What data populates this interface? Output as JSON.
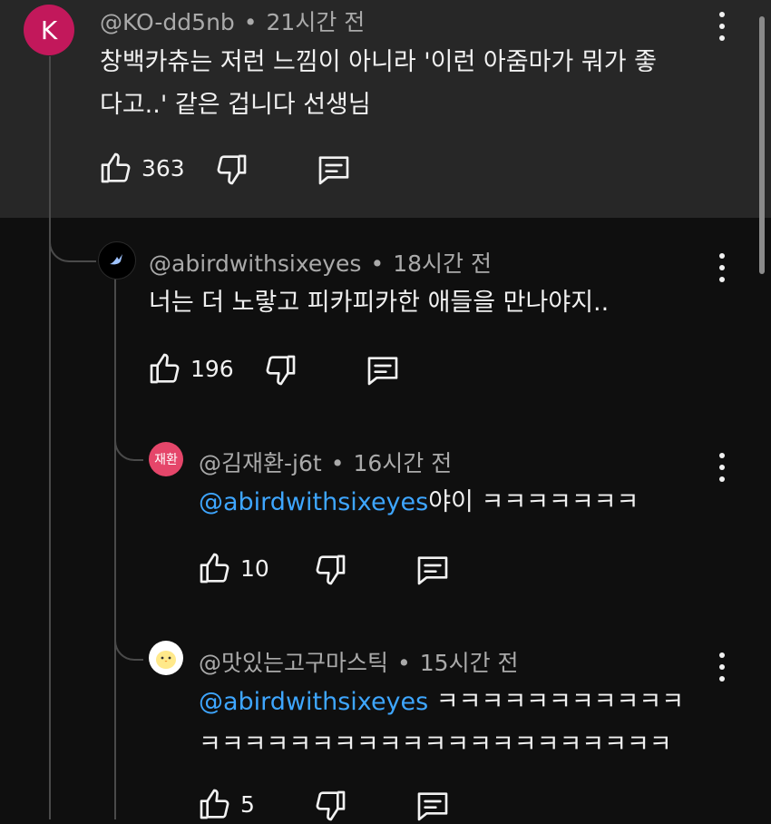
{
  "comments": [
    {
      "avatar_letter": "K",
      "avatar_color": "#c2185b",
      "author": "@KO-dd5nb",
      "time": "21시간 전",
      "text_line1": "창백카츄는 저런 느낌이 아니라 '이런 아줌마가 뭐가 좋",
      "text_line2": "다고..' 같은 겁니다 선생님",
      "likes": "363"
    },
    {
      "avatar_icon": "bird-avatar",
      "author": "@abirdwithsixeyes",
      "time": "18시간 전",
      "text": "너는 더 노랗고 피카피카한 애들을 만나야지..",
      "likes": "196"
    },
    {
      "avatar_text": "재환",
      "avatar_color": "#e5466a",
      "author": "@김재환-j6t",
      "time": "16시간 전",
      "mention": "@abirdwithsixeyes",
      "text": "야이 ㅋㅋㅋㅋㅋㅋㅋ",
      "likes": "10"
    },
    {
      "avatar_icon": "chick-avatar",
      "author": "@맛있는고구마스틱",
      "time": "15시간 전",
      "mention": "@abirdwithsixeyes",
      "text_line1": " ㅋㅋㅋㅋㅋㅋㅋㅋㅋㅋㅋ",
      "text_line2": "ㅋㅋㅋㅋㅋㅋㅋㅋㅋㅋㅋㅋㅋㅋㅋㅋㅋㅋㅋㅋㅋ",
      "likes": "5"
    }
  ],
  "icons": {
    "like": "thumbs-up-icon",
    "dislike": "thumbs-down-icon",
    "reply": "reply-comment-icon",
    "menu": "more-vertical-icon"
  },
  "colors": {
    "background": "#0f0f0f",
    "highlight": "#272727",
    "mention": "#3ea6ff",
    "meta_text": "#aaaaaa"
  }
}
